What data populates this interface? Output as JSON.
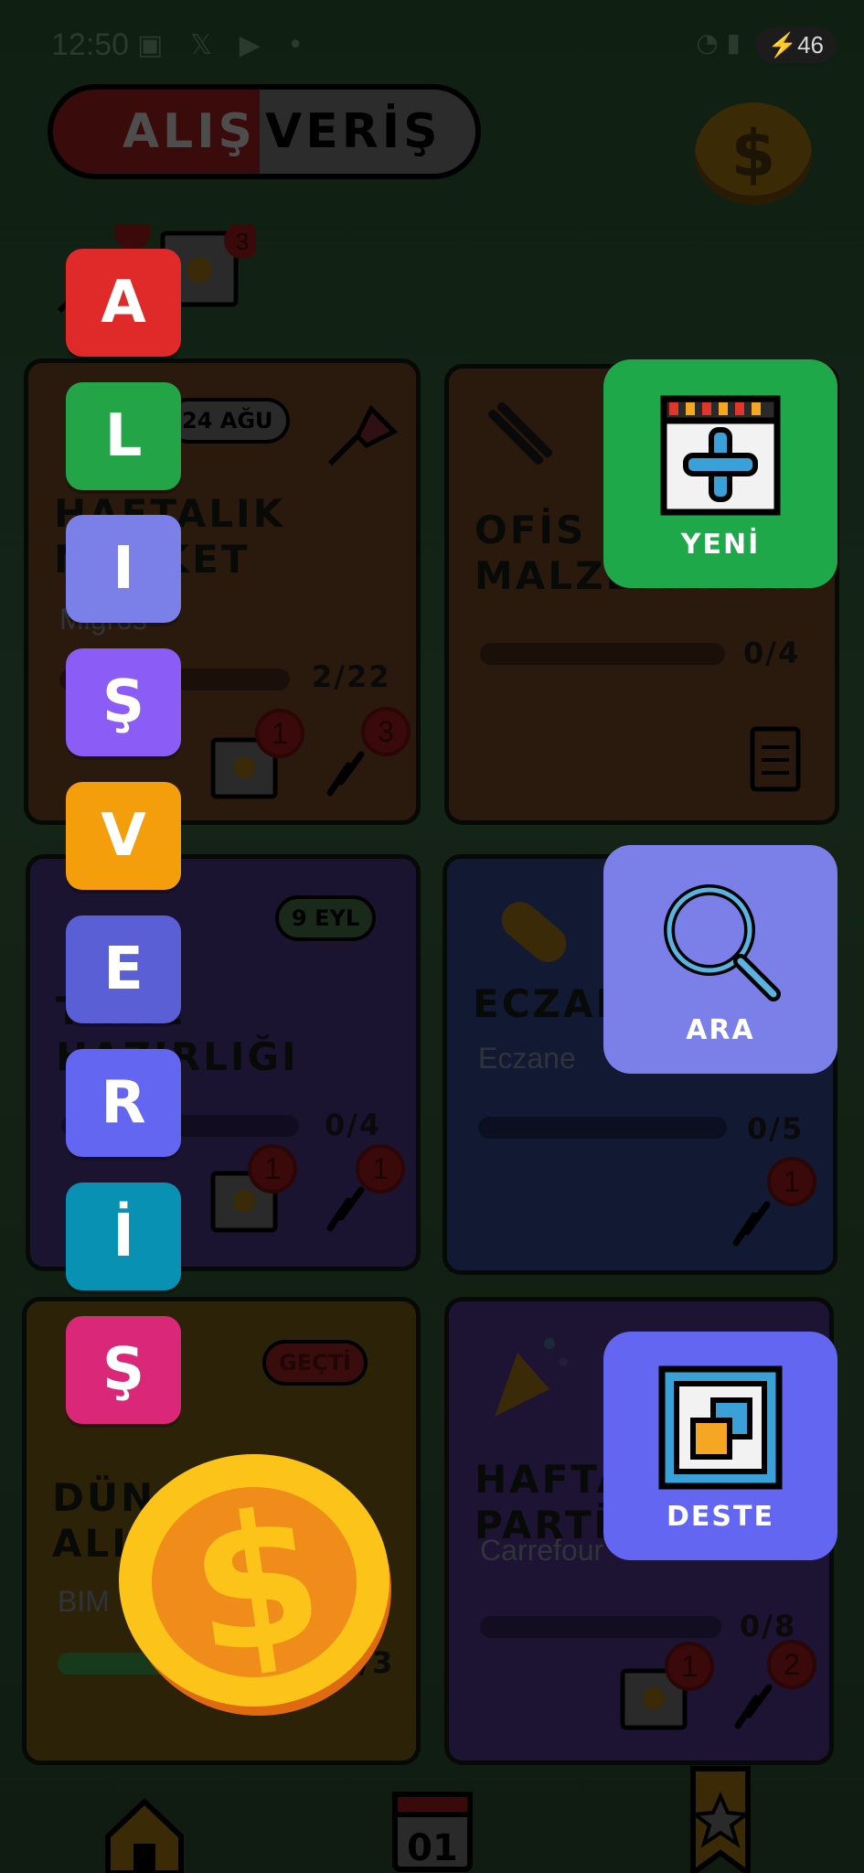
{
  "status_bar": {
    "time": "12:50",
    "battery": "46",
    "battery_icon": "charging-bolt"
  },
  "header": {
    "title_left": "ALIŞ",
    "title_right": "VERİŞ",
    "coin_symbol": "$"
  },
  "cards": [
    {
      "title_line1": "HAFTALIK",
      "title_line2": "MARKET",
      "subtitle": "Migros",
      "date_day": "24",
      "date_month": "AĞU",
      "progress": "2/22",
      "photo_badge": "1",
      "link_badge": "3"
    },
    {
      "title_line1": "OFİS",
      "title_line2": "MALZEMELERİ",
      "progress": "0/4"
    },
    {
      "date_day": "9",
      "date_month": "EYL",
      "title_line1": "TATİL",
      "title_line2": "HAZIRLIĞI",
      "progress": "0/4",
      "photo_badge": "1",
      "link_badge": "1"
    },
    {
      "title_line1": "ECZANE",
      "subtitle": "Eczane",
      "progress": "0/5",
      "link_badge": "1"
    },
    {
      "status": "GEÇTİ",
      "title_line1": "DÜN",
      "title_line2": "ALIŞVERİŞ",
      "subtitle": "BIM",
      "progress": "3/3"
    },
    {
      "title_line1": "HAFTA SONU",
      "title_line2": "PARTİ",
      "subtitle": "Carrefour",
      "progress": "0/8",
      "photo_badge": "1",
      "link_badge": "2"
    }
  ],
  "letters": [
    {
      "char": "A",
      "color": "#e02a2a"
    },
    {
      "char": "L",
      "color": "#22a447"
    },
    {
      "char": "I",
      "color": "#7b7fe8"
    },
    {
      "char": "Ş",
      "color": "#8b5cf6"
    },
    {
      "char": "V",
      "color": "#f59e0b"
    },
    {
      "char": "E",
      "color": "#5b5fd6"
    },
    {
      "char": "R",
      "color": "#6366f1"
    },
    {
      "char": "İ",
      "color": "#0891b2"
    },
    {
      "char": "Ş",
      "color": "#db2777"
    }
  ],
  "actions": {
    "new": {
      "label": "YENİ",
      "color": "#1fa84a"
    },
    "search": {
      "label": "ARA",
      "color": "#7b7fe8"
    },
    "deck": {
      "label": "DESTE",
      "color": "#6366f1"
    }
  },
  "coin_symbol": "$",
  "calendar_day": "01"
}
